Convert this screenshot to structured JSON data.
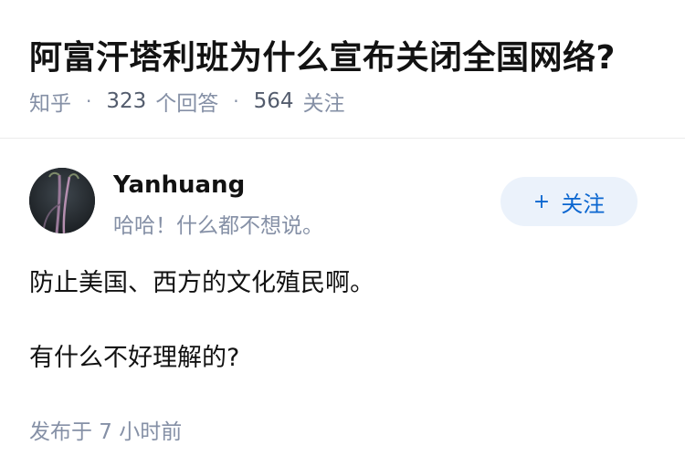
{
  "question": {
    "title": "阿富汗塔利班为什么宣布关闭全国网络?",
    "source": "知乎",
    "answer_count": "323",
    "answer_label": "个回答",
    "follower_count": "564",
    "follower_label": "关注"
  },
  "author": {
    "name": "Yanhuang",
    "bio": "哈哈！什么都不想说。",
    "avatar_icon": "avatar-image",
    "follow_label": "关注",
    "follow_icon": "plus-icon"
  },
  "answer": {
    "paragraphs": [
      "防止美国、西方的文化殖民啊。",
      "有什么不好理解的?"
    ],
    "time": "发布于 7 小时前"
  },
  "colors": {
    "accent": "#0a66d0",
    "follow_bg": "#ebf2fb",
    "meta": "#8590a6"
  }
}
